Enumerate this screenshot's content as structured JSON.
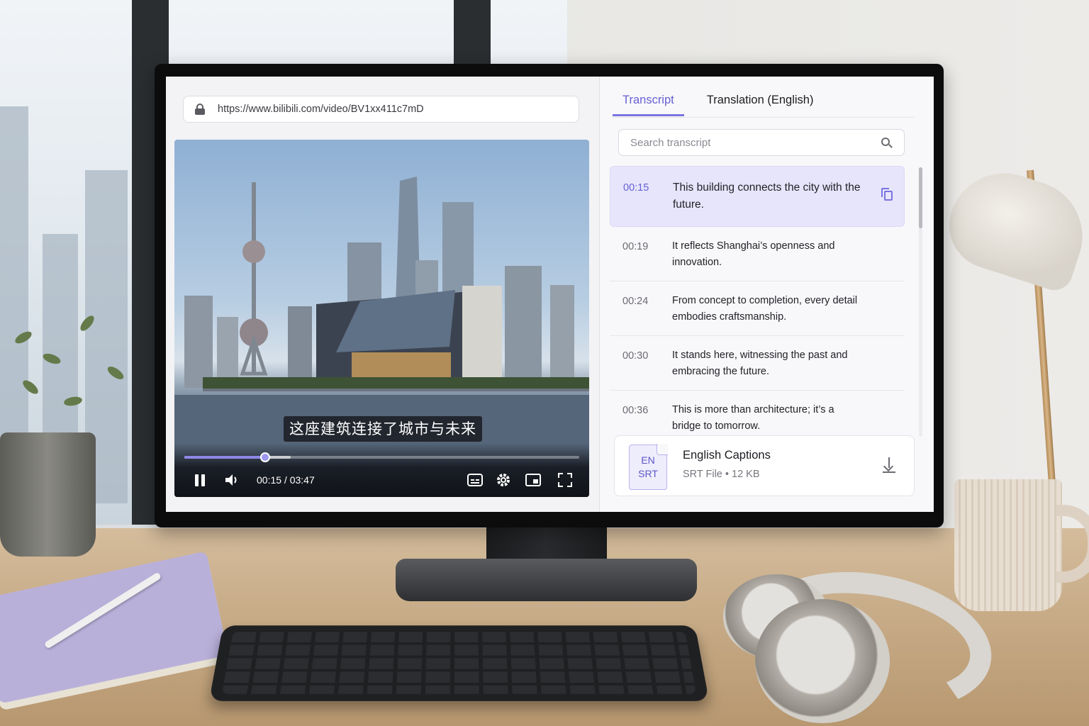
{
  "browser": {
    "url": "https://www.bilibili.com/video/BV1xx411c7mD"
  },
  "player": {
    "subtitle": "这座建筑连接了城市与未来",
    "time_display": "00:15 / 03:47",
    "progress_fraction": 0.066,
    "buffered_fraction": 0.27,
    "accent_color": "#8f87e6"
  },
  "tabs": [
    {
      "label": "Transcript",
      "active": true
    },
    {
      "label": "Translation (English)",
      "active": false
    }
  ],
  "search": {
    "placeholder": "Search transcript",
    "value": ""
  },
  "transcript": [
    {
      "time": "00:15",
      "text": "This building connects the city with the future.",
      "active": true
    },
    {
      "time": "00:19",
      "text": "It reflects Shanghai’s openness and innovation.",
      "active": false
    },
    {
      "time": "00:24",
      "text": "From concept to completion, every detail embodies craftsmanship.",
      "active": false
    },
    {
      "time": "00:30",
      "text": "It stands here, witnessing the past and embracing the future.",
      "active": false
    },
    {
      "time": "00:36",
      "text": "This is more than architecture; it’s a bridge to tomorrow.",
      "active": false
    }
  ],
  "captions_file": {
    "icon_line1": "EN",
    "icon_line2": "SRT",
    "title": "English Captions",
    "meta": "SRT File • 12 KB"
  },
  "colors": {
    "accent": "#6760d4",
    "active_row_bg": "#e7e5fb"
  },
  "icons": [
    "lock-icon",
    "pause-icon",
    "volume-icon",
    "captions-icon",
    "gear-icon",
    "picture-in-picture-icon",
    "fullscreen-icon",
    "search-icon",
    "copy-icon",
    "file-icon",
    "download-icon"
  ]
}
